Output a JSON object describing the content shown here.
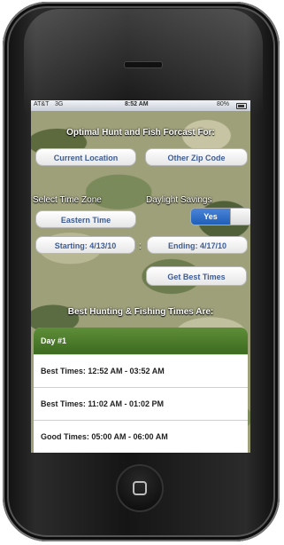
{
  "status": {
    "carrier": "AT&T",
    "network": "3G",
    "time": "8:52 AM",
    "battery": "80%"
  },
  "header": {
    "title": "Optimal Hunt and Fish Forcast For:"
  },
  "location": {
    "current_label": "Current Location",
    "zip_label": "Other Zip Code"
  },
  "timezone": {
    "label": "Select Time Zone",
    "value": "Eastern Time"
  },
  "daylight": {
    "label": "Daylight Savings",
    "toggle_value": "Yes"
  },
  "dates": {
    "starting": "Starting: 4/13/10",
    "separator": ":",
    "ending": "Ending: 4/17/10"
  },
  "actions": {
    "get_best_times": "Get Best Times"
  },
  "results": {
    "title": "Best Hunting & Fishing Times Are:",
    "day_label": "Day #1",
    "rows": [
      "Best Times: 12:52 AM - 03:52 AM",
      "Best Times: 11:02 AM - 01:02 PM",
      "Good Times: 05:00 AM - 06:00 AM"
    ]
  }
}
